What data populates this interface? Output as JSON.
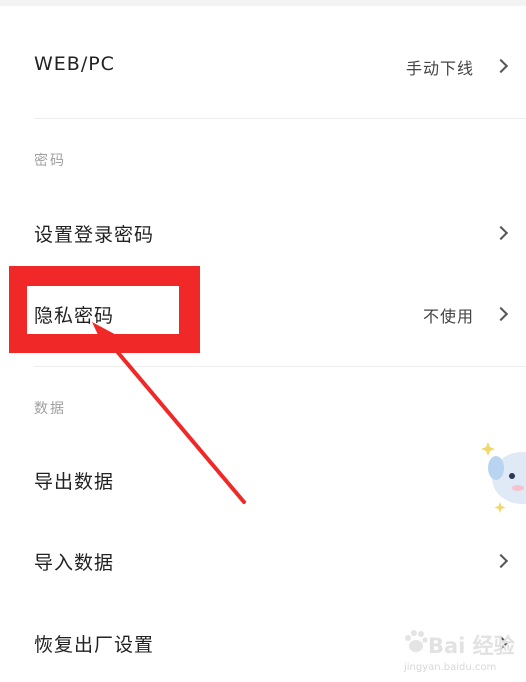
{
  "rows": {
    "web_pc": {
      "label": "WEB/PC",
      "value": "手动下线"
    },
    "set_login_password": {
      "label": "设置登录密码"
    },
    "privacy_password": {
      "label": "隐私密码",
      "value": "不使用"
    },
    "export_data": {
      "label": "导出数据"
    },
    "import_data": {
      "label": "导入数据"
    },
    "factory_reset": {
      "label": "恢复出厂设置"
    }
  },
  "sections": {
    "password": "密码",
    "data": "数据"
  },
  "watermark": {
    "brand": "Bai 经验",
    "url": "jingyan.baidu.com"
  },
  "colors": {
    "highlight": "#f02828",
    "arrow": "#f02828"
  }
}
